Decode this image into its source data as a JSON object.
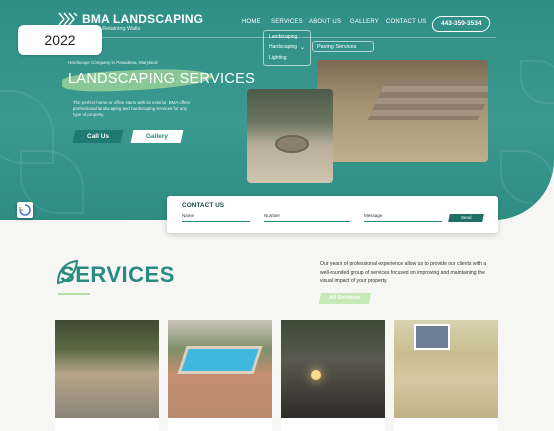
{
  "brand": {
    "name": "BMA LANDSCAPING",
    "tagline": "Patios • Retaining Walls"
  },
  "nav": {
    "items": [
      "HOME",
      "SERVICES",
      "ABOUT US",
      "GALLERY",
      "CONTACT US"
    ],
    "phone": "443-359-3534"
  },
  "dropdown": {
    "items": [
      "Landscaping",
      "Hardscaping",
      "Lighting"
    ],
    "submenu": "Paving Services"
  },
  "badge": {
    "year": "2022"
  },
  "hero": {
    "kicker": "Hardscape Company in Pasadena, Maryland",
    "title": "LANDSCAPING SERVICES",
    "description": "The perfect home or office starts with its exterior. BMA offers professional landscaping and hardscaping services for any type of property.",
    "call_label": "Call Us",
    "gallery_label": "Gallery"
  },
  "contact": {
    "title": "CONTACT US",
    "fields": [
      "Name",
      "Number",
      "Message"
    ],
    "send_label": "Send"
  },
  "services": {
    "title_rest": "ERVICES",
    "title_initial": "S",
    "intro": "Our years of professional experience allow us to provide our clients with a well-rounded group of services focused on improving and maintaining the visual impact of your property.",
    "all_label": "All Services"
  },
  "colors": {
    "teal": "#2f8f86",
    "dark_teal": "#1f7a71",
    "accent_green": "#c6eab7"
  }
}
